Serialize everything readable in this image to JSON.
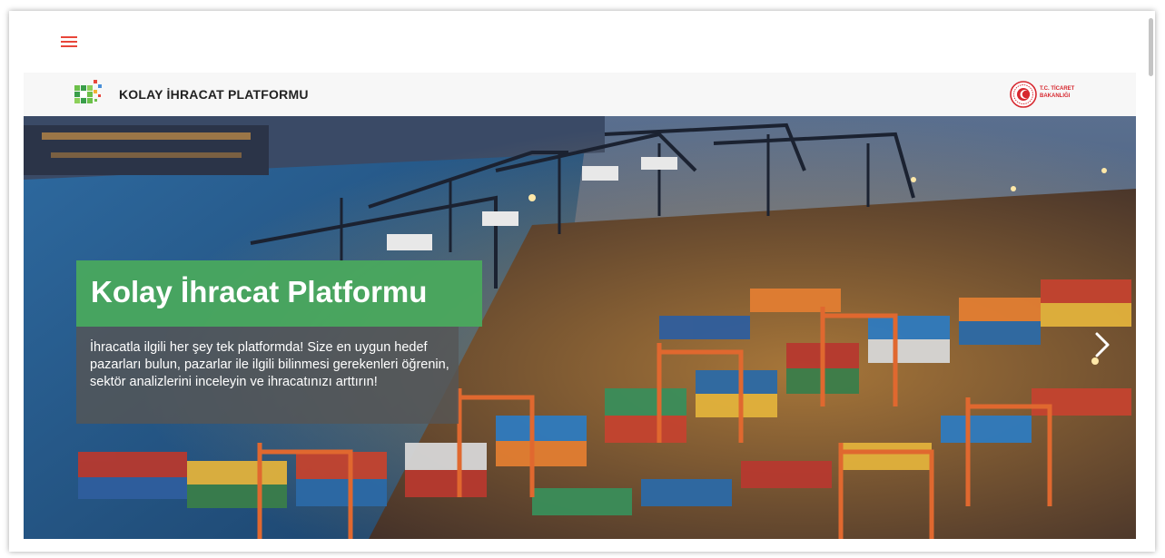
{
  "header": {
    "brand_name": "KOLAY İHRACAT PLATFORMU",
    "ministry_label_line1": "T.C. TİCARET",
    "ministry_label_line2": "BAKANLIĞI"
  },
  "hero": {
    "title": "Kolay İhracat Platformu",
    "description": "İhracatla ilgili her şey tek platformda! Size en uygun hedef pazarları bulun, pazarlar ile ilgili bilinmesi gerekenleri öğrenin, sektör analizlerini inceleyin ve ihracatınızı arttırın!"
  },
  "icons": {
    "menu": "hamburger-menu-icon",
    "next": "chevron-right-icon",
    "logo": "kip-logo-icon",
    "ministry": "ministry-seal-icon"
  },
  "colors": {
    "accent_red": "#e8463a",
    "title_green": "#4aaa5c",
    "ministry_red": "#d7282f",
    "desc_overlay": "#555555"
  }
}
